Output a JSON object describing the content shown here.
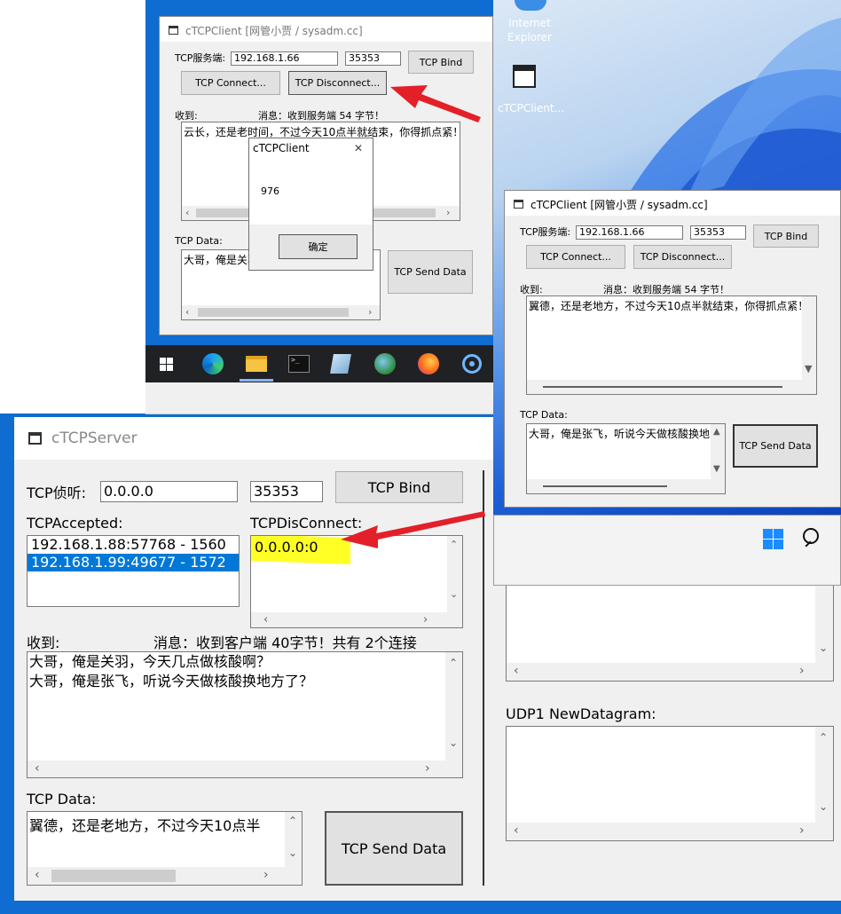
{
  "colors": {
    "desktop": "#0f6cd0",
    "taskbar": "#202124",
    "selection": "#0078d7",
    "highlight": "#ffff00",
    "annotation_arrow": "#e3202a"
  },
  "desktop": {
    "icons": [
      {
        "name": "internet-explorer-icon",
        "label": "Internet Explorer"
      },
      {
        "name": "app-window-icon",
        "label": "cTCPClient..."
      }
    ]
  },
  "taskbar_top": {
    "icons": [
      "windows-start-icon",
      "edge-icon",
      "file-explorer-icon",
      "terminal-icon",
      "pen-tablet-icon",
      "globe-icon",
      "firefox-icon",
      "broadcast-icon"
    ]
  },
  "taskbar_right": {
    "icons": [
      "windows-start-icon",
      "search-icon"
    ]
  },
  "client1": {
    "title": "cTCPClient [网管小贾 / sysadm.cc]",
    "server_label": "TCP服务端:",
    "ip": "192.168.1.66",
    "port": "35353",
    "bind": "TCP Bind",
    "connect": "TCP Connect...",
    "disconnect": "TCP Disconnect...",
    "recv_label": "收到:",
    "msg": "消息：收到服务端 54 字节！",
    "recv_text": "云长，还是老时间，不过今天10点半就结束，你得抓点紧！",
    "data_label": "TCP Data:",
    "data_text": "大哥，俺是关羽",
    "send": "TCP Send Data"
  },
  "dialog": {
    "title": "cTCPClient",
    "close": "✕",
    "message": "976",
    "ok": "确定"
  },
  "client2": {
    "title": "cTCPClient [网管小贾 / sysadm.cc]",
    "server_label": "TCP服务端:",
    "ip": "192.168.1.66",
    "port": "35353",
    "bind": "TCP Bind",
    "connect": "TCP Connect...",
    "disconnect": "TCP Disconnect...",
    "recv_label": "收到:",
    "msg": "消息：收到服务端 54 字节！",
    "recv_text": "翼德，还是老地方，不过今天10点半就结束，你得抓点紧！",
    "data_label": "TCP Data:",
    "data_text": "大哥，俺是张飞，听说今天做核酸换地",
    "send": "TCP Send Data"
  },
  "server": {
    "title": "cTCPServer",
    "listen_label": "TCP侦听:",
    "ip": "0.0.0.0",
    "port": "35353",
    "bind": "TCP Bind",
    "accepted_label": "TCPAccepted:",
    "accepted": [
      "192.168.1.88:57768 - 1560",
      "192.168.1.99:49677 - 1572"
    ],
    "selected_index": 1,
    "disconnect_label": "TCPDisConnect:",
    "disconnect_items": [
      "0.0.0.0:0"
    ],
    "recv_label": "收到:",
    "msg": "消息：收到客户端 40字节！共有 2个连接",
    "recv_lines": [
      "大哥，俺是关羽，今天几点做核酸啊？",
      "大哥，俺是张飞，听说今天做核酸换地方了？"
    ],
    "data_label": "TCP Data:",
    "data_text": "翼德，还是老地方，不过今天10点半",
    "send": "TCP Send Data",
    "udp_label": "UDP1 NewDatagram:"
  }
}
